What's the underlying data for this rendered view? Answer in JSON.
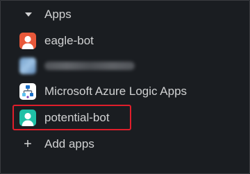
{
  "section": {
    "title": "Apps",
    "add_label": "Add apps",
    "add_icon": "plus-icon"
  },
  "apps": [
    {
      "label": "eagle-bot",
      "icon": "bot-avatar-icon",
      "color": "#e8583a"
    },
    {
      "label": "",
      "icon": "blurred-avatar-icon",
      "color": "#7fb0dc"
    },
    {
      "label": "Microsoft Azure Logic Apps",
      "icon": "azure-logic-apps-icon",
      "color": "#ffffff"
    },
    {
      "label": "potential-bot",
      "icon": "bot-avatar-icon",
      "color": "#1fc0a6"
    }
  ],
  "highlight_color": "#e01e2b"
}
